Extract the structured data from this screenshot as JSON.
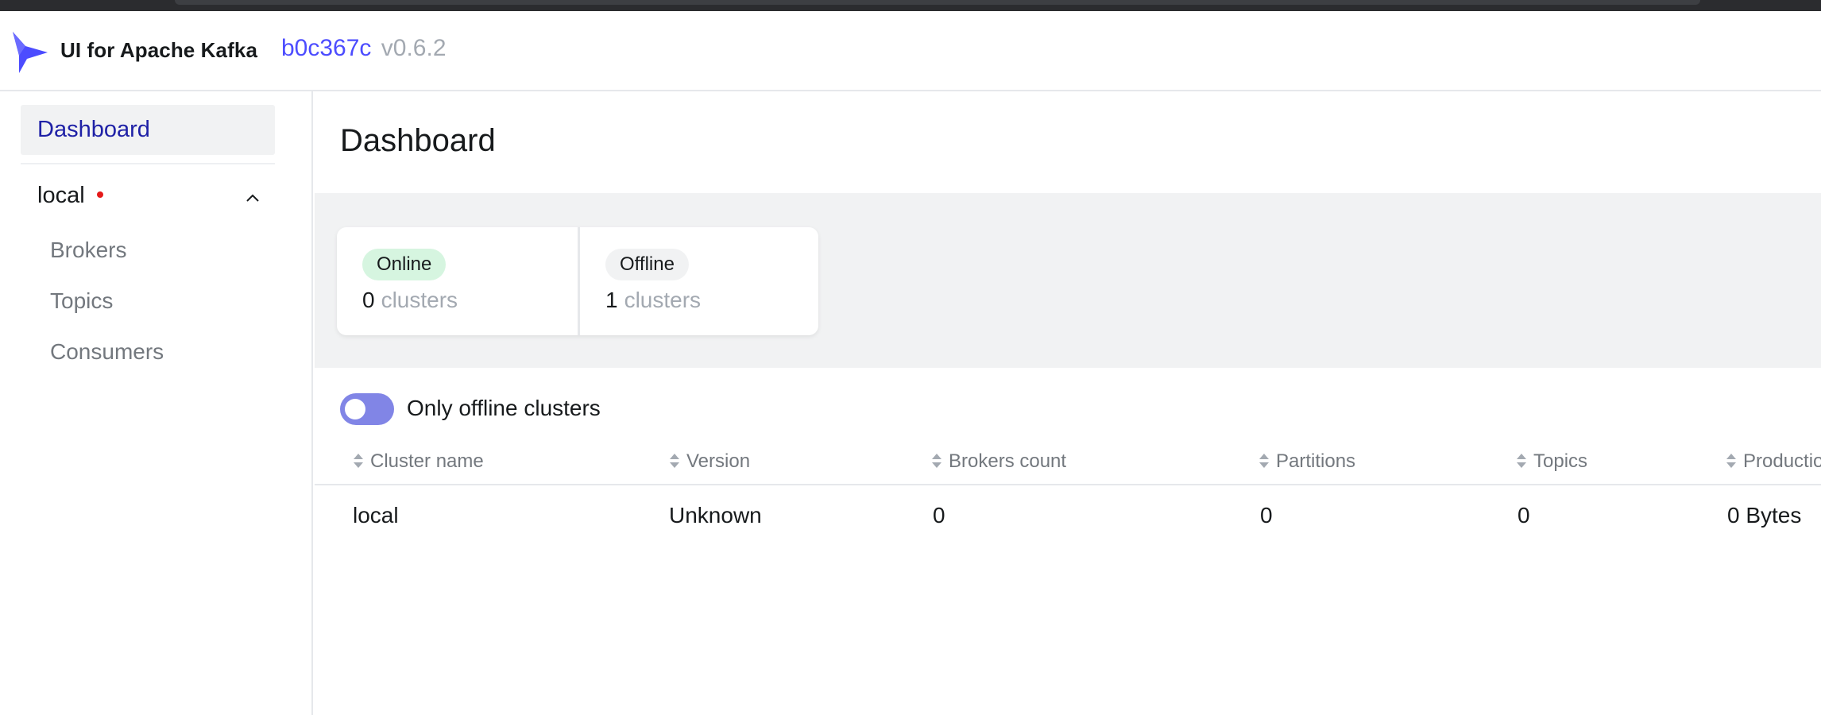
{
  "header": {
    "app_title": "UI for Apache Kafka",
    "commit": "b0c367c",
    "version": "v0.6.2",
    "icon": "kafka-bird-logo"
  },
  "sidebar": {
    "dashboard_label": "Dashboard",
    "cluster": {
      "name": "local",
      "status": "offline",
      "status_color": "#e51a1a",
      "expanded": true,
      "items": [
        {
          "label": "Brokers"
        },
        {
          "label": "Topics"
        },
        {
          "label": "Consumers"
        }
      ]
    }
  },
  "main": {
    "title": "Dashboard",
    "metrics": {
      "online": {
        "label": "Online",
        "value": "0",
        "unit": "clusters"
      },
      "offline": {
        "label": "Offline",
        "value": "1",
        "unit": "clusters"
      }
    },
    "toggle": {
      "label": "Only offline clusters",
      "on": true
    },
    "table": {
      "columns": [
        {
          "label": "Cluster name"
        },
        {
          "label": "Version"
        },
        {
          "label": "Brokers count"
        },
        {
          "label": "Partitions"
        },
        {
          "label": "Topics"
        },
        {
          "label": "Production"
        }
      ],
      "rows": [
        {
          "cells": [
            "local",
            "Unknown",
            "0",
            "0",
            "0",
            "0 Bytes"
          ]
        }
      ]
    }
  },
  "colors": {
    "accent": "#4c4cff",
    "nav_active_text": "#1f21a6",
    "toggle_on": "#8185e6",
    "online_pill": "#d6f5e0",
    "muted_text": "#a3a9b1"
  }
}
